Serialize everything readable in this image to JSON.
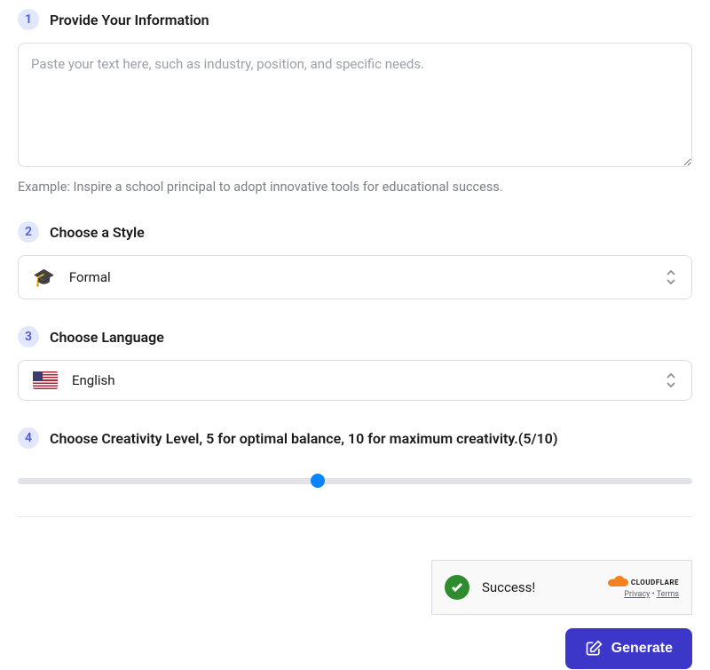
{
  "step1": {
    "number": "1",
    "title": "Provide Your Information",
    "placeholder": "Paste your text here, such as industry, position, and specific needs.",
    "example": "Example:  Inspire a school principal to adopt innovative tools for educational success."
  },
  "step2": {
    "number": "2",
    "title": "Choose a Style",
    "icon": "🎓",
    "selected": "Formal"
  },
  "step3": {
    "number": "3",
    "title": "Choose Language",
    "selected": "English"
  },
  "step4": {
    "number": "4",
    "title": "Choose Creativity Level, 5 for optimal balance, 10 for maximum creativity.(5/10)",
    "value": 5,
    "max": 10
  },
  "captcha": {
    "status": "Success!",
    "brand": "CLOUDFLARE",
    "privacy": "Privacy",
    "terms": "Terms"
  },
  "actions": {
    "generate": "Generate"
  },
  "slider_percent": "44.5%"
}
